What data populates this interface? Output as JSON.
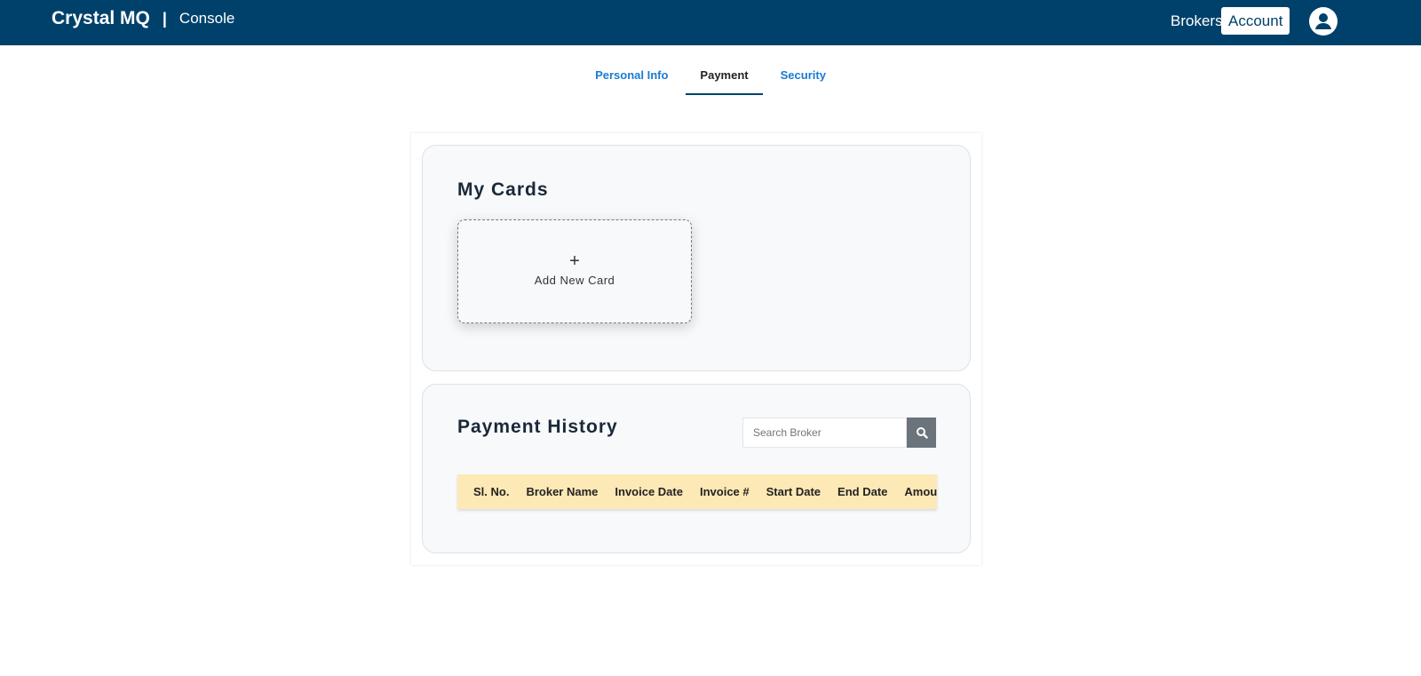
{
  "header": {
    "brand": "Crystal MQ",
    "separator": "|",
    "product": "Console",
    "nav_brokers": "Brokers",
    "nav_account": "Account",
    "avatar_icon": "user-icon"
  },
  "tabs": [
    {
      "label": "Personal Info",
      "active": false
    },
    {
      "label": "Payment",
      "active": true
    },
    {
      "label": "Security",
      "active": false
    }
  ],
  "cards": {
    "title": "My Cards",
    "add_icon": "plus-icon",
    "add_label": "Add New Card"
  },
  "history": {
    "title": "Payment History",
    "search_placeholder": "Search Broker",
    "search_icon": "search-icon",
    "columns": [
      "Sl. No.",
      "Broker Name",
      "Invoice Date",
      "Invoice #",
      "Start Date",
      "End Date",
      "Amount"
    ]
  }
}
